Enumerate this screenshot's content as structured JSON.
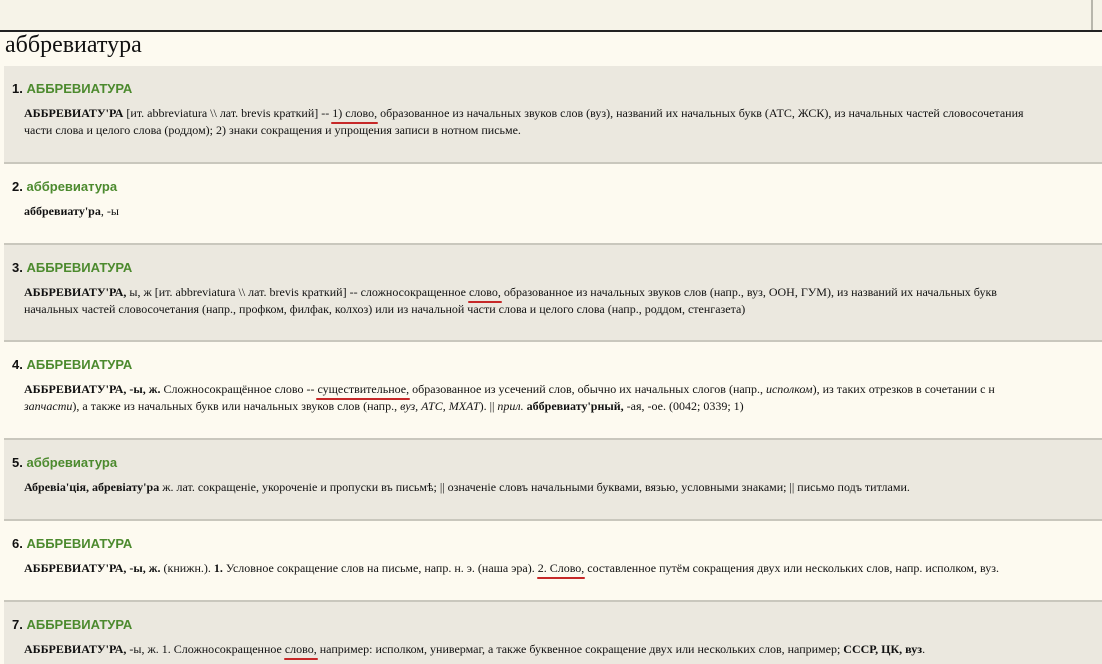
{
  "page": {
    "word": "аббревиатура"
  },
  "entries": [
    {
      "num": "1.",
      "headword": "АББРЕВИАТУРА",
      "lines": [
        [
          {
            "t": "АББРЕВИАТУ'РА",
            "s": "b"
          },
          {
            "t": " [ит. abbreviatura \\\\ лат. brevis краткий] -- "
          },
          {
            "t": "1) слово,",
            "s": "u"
          },
          {
            "t": " образованное из начальных звуков слов (вуз), названий их начальных букв (АТС, ЖСК), из начальных частей словосочетания"
          }
        ],
        [
          {
            "t": "части слова и целого слова (роддом); 2) знаки сокращения и упрощения записи в нотном письме."
          }
        ]
      ]
    },
    {
      "num": "2.",
      "headword": "аббревиатура",
      "lines": [
        [
          {
            "t": "аббревиату'ра",
            "s": "b"
          },
          {
            "t": ", -ы"
          }
        ]
      ]
    },
    {
      "num": "3.",
      "headword": "АББРЕВИАТУРА",
      "lines": [
        [
          {
            "t": "АББРЕВИАТУ'РА,",
            "s": "b"
          },
          {
            "t": " ы, ж [ит. abbreviatura \\\\ лат. brevis краткий] -- сложносокращенное "
          },
          {
            "t": "слово,",
            "s": "u"
          },
          {
            "t": " образованное из начальных звуков слов (напр., вуз, ООН, ГУМ), из названий их начальных букв"
          }
        ],
        [
          {
            "t": "начальных частей словосочетания (напр., профком, филфак, колхоз) или из начальной части слова и целого слова (напр., роддом, стенгазета)"
          }
        ]
      ]
    },
    {
      "num": "4.",
      "headword": "АББРЕВИАТУРА",
      "lines": [
        [
          {
            "t": "АББРЕВИАТУ'РА,",
            "s": "b"
          },
          {
            "t": " "
          },
          {
            "t": "-ы, ж.",
            "s": "b"
          },
          {
            "t": " Сложносокращённое слово -- "
          },
          {
            "t": "существительное,",
            "s": "u"
          },
          {
            "t": " образованное из усечений слов, обычно их начальных слогов (напр., "
          },
          {
            "t": "исполком",
            "s": "i"
          },
          {
            "t": "), из таких отрезков в сочетании с н"
          }
        ],
        [
          {
            "t": "запчасти",
            "s": "i"
          },
          {
            "t": "), а также из начальных букв или начальных звуков слов (напр., "
          },
          {
            "t": "вуз, АТС, МХАТ",
            "s": "i"
          },
          {
            "t": "). || "
          },
          {
            "t": "прил.",
            "s": "i"
          },
          {
            "t": " "
          },
          {
            "t": "аббревиату'рный,",
            "s": "b"
          },
          {
            "t": " -ая, -ое. (0042; 0339; 1)"
          }
        ]
      ]
    },
    {
      "num": "5.",
      "headword": "аббревиатура",
      "lines": [
        [
          {
            "t": "Абревіа'ція, абревіату'ра",
            "s": "b"
          },
          {
            "t": " ж. лат. сокращеніе, укороченіе и пропуски въ письмѣ; || означеніе словъ начальными буквами, вязью, условными знаками; || письмо подъ титлами."
          }
        ]
      ]
    },
    {
      "num": "6.",
      "headword": "АББРЕВИАТУРА",
      "lines": [
        [
          {
            "t": "АББРЕВИАТУ'РА,",
            "s": "b"
          },
          {
            "t": " "
          },
          {
            "t": "-ы, ж.",
            "s": "b"
          },
          {
            "t": " (книжн.). "
          },
          {
            "t": "1.",
            "s": "b"
          },
          {
            "t": " Условное сокращение слов на письме, напр. н. э. (наша эра). "
          },
          {
            "t": "2. Слово,",
            "s": "u"
          },
          {
            "t": " составленное путём сокращения двух или нескольких слов, напр. исполком, вуз."
          }
        ]
      ]
    },
    {
      "num": "7.",
      "headword": "АББРЕВИАТУРА",
      "lines": [
        [
          {
            "t": "АББРЕВИАТУ'РА,",
            "s": "b"
          },
          {
            "t": " -ы, ж. 1. Сложносокращенное "
          },
          {
            "t": "слово,",
            "s": "u"
          },
          {
            "t": " например: исполком, универмаг, а также буквенное сокращение двух или нескольких слов, например; "
          },
          {
            "t": "СССР, ЦК, вуз",
            "s": "b"
          },
          {
            "t": "."
          }
        ]
      ]
    }
  ]
}
